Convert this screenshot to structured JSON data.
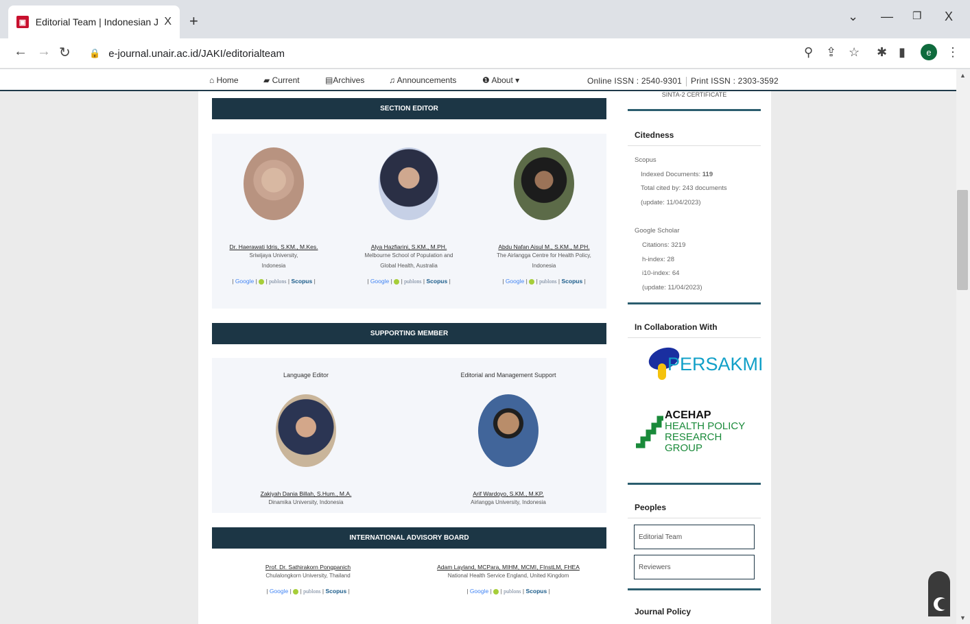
{
  "browser": {
    "tab_title": "Editorial Team | Indonesian Journ",
    "tab_close": "X",
    "new_tab": "+",
    "url": "e-journal.unair.ac.id/JAKI/editorialteam",
    "win_min": "—",
    "win_restore": "❐",
    "win_close": "X",
    "profile_initial": "e"
  },
  "nav": {
    "home": "Home",
    "current": "Current",
    "archives": "Archives",
    "announcements": "Announcements",
    "about": "About",
    "online_issn": "Online ISSN : 2540-9301",
    "print_issn": "Print ISSN : 2303-3592"
  },
  "section_editor": {
    "header": "SECTION EDITOR",
    "people": [
      {
        "name": "Dr. Haerawati Idris, S.KM., M.Kes.",
        "aff1": "Sriwijaya University,",
        "aff2": "Indonesia"
      },
      {
        "name": "Alya Hazfiarini, S.KM., M.PH.",
        "aff1": "Melbourne School of Population and",
        "aff2": "Global Health, Australia"
      },
      {
        "name": "Abdu Nafan Aisul M., S.KM., M.PH.",
        "aff1": "The Airlangga Centre for Health Policy,",
        "aff2": "Indonesia"
      }
    ]
  },
  "links": {
    "google": "Google",
    "publons": "publons",
    "scopus": "Scopus",
    "sep": "|"
  },
  "supporting_member": {
    "header": "SUPPORTING MEMBER",
    "roles": [
      "Language Editor",
      "Editorial and Management Support"
    ],
    "people": [
      {
        "name": "Zakiyah Dania Billah, S.Hum., M.A.",
        "aff": "Dinamika University, Indonesia"
      },
      {
        "name": "Arif Wardoyo, S.KM., M.KP.",
        "aff": "Airlangga University, Indonesia"
      }
    ]
  },
  "advisory_board": {
    "header": "INTERNATIONAL ADVISORY BOARD",
    "people": [
      {
        "name": "Prof. Dr. Sathirakorn Pongpanich",
        "aff": "Chulalongkorn University, Thailand"
      },
      {
        "name": "Adam Layland, MCPara, MIHM, MCMI, FInstLM, FHEA",
        "aff": "National Health Service England, United Kingdom"
      }
    ]
  },
  "sidebar": {
    "sinta": "SINTA-2 CERTIFICATE",
    "citedness": {
      "title": "Citedness",
      "scopus_label": "Scopus",
      "indexed_label": "Indexed Documents:",
      "indexed_value": "119",
      "total_cited": "Total cited by: 243 documents",
      "scopus_update": "(update: 11/04/2023)",
      "gs_label": "Google Scholar",
      "citations": "Citations: 3219",
      "h_index": "h-index: 28",
      "i10_index": "i10-index: 64",
      "gs_update": "(update: 11/04/2023)"
    },
    "collab": {
      "title": "In Collaboration With",
      "persakmi": "PERSAKMI",
      "acehap_1": "ACEHAP",
      "acehap_2": "HEALTH POLICY",
      "acehap_3": "RESEARCH GROUP"
    },
    "peoples": {
      "title": "Peoples",
      "items": [
        "Editorial Team",
        "Reviewers"
      ]
    },
    "journal_policy": "Journal Policy"
  }
}
